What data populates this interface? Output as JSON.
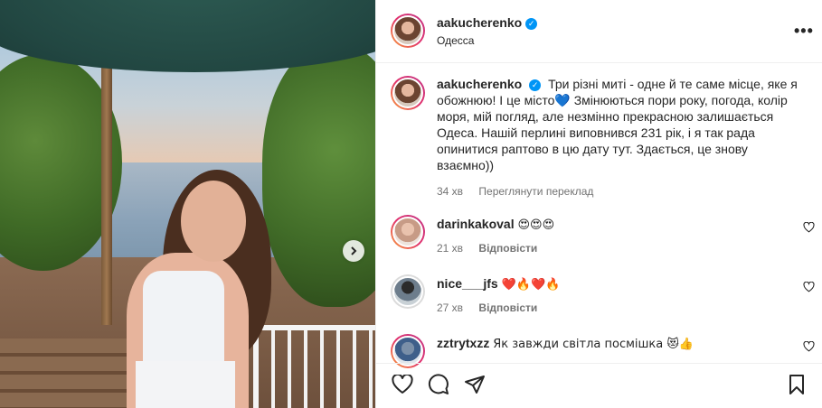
{
  "post": {
    "author": "aakucherenko",
    "location": "Одесса",
    "more_glyph": "•••",
    "caption_text": "Три різні миті - одне й те саме місце, яке я обожнюю! І це місто💙 Змінюються пори року, погода, колір моря, мій погляд, але незмінно прекрасною залишається Одеса. Нашій перлині виповнився 231 рік, і я так рада опинитися раптово в цю дату тут. Здається, це знову взаємно))",
    "caption_time": "34 хв",
    "translate_label": "Переглянути переклад"
  },
  "comments": [
    {
      "username": "darinkakoval",
      "text": "😍😍😍",
      "time": "21 хв",
      "reply_label": "Відповісти"
    },
    {
      "username": "nice___jfs",
      "text": "❤️🔥❤️🔥",
      "time": "27 хв",
      "reply_label": "Відповісти"
    },
    {
      "username": "zztrytxzz",
      "text": "Як завжди світла посмішка 😻👍",
      "time": "",
      "reply_label": ""
    }
  ],
  "icons": {
    "next": "chevron-right-icon",
    "like": "heart-icon",
    "comment": "comment-icon",
    "share": "send-icon",
    "save": "bookmark-icon"
  },
  "colors": {
    "verified": "#0095f6",
    "meta": "#737373",
    "text": "#262626"
  }
}
